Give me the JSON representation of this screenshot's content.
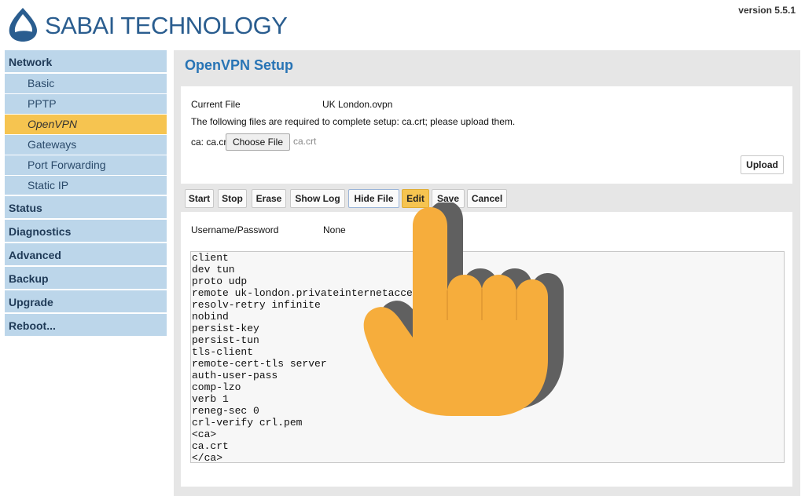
{
  "header": {
    "brand": "SABAI TECHNOLOGY",
    "version": "version 5.5.1"
  },
  "sidebar": {
    "sections": [
      {
        "label": "Network",
        "items": [
          "Basic",
          "PPTP",
          "OpenVPN",
          "Gateways",
          "Port Forwarding",
          "Static IP"
        ],
        "active_item": "OpenVPN"
      },
      {
        "label": "Status"
      },
      {
        "label": "Diagnostics"
      },
      {
        "label": "Advanced"
      },
      {
        "label": "Backup"
      },
      {
        "label": "Upgrade"
      },
      {
        "label": "Reboot..."
      }
    ]
  },
  "main": {
    "title": "OpenVPN Setup",
    "current_file_label": "Current File",
    "current_file_value": "UK London.ovpn",
    "required_note": "The following files are required to complete setup: ca.crt; please upload them.",
    "upload_field_label": "ca: ca.crt",
    "choose_file_label": "Choose File",
    "chosen_file": "ca.crt",
    "upload_label": "Upload",
    "toolbar": {
      "start": "Start",
      "stop": "Stop",
      "erase": "Erase",
      "show_log": "Show Log",
      "hide_file": "Hide File",
      "edit": "Edit",
      "save": "Save",
      "cancel": "Cancel"
    },
    "username_password_label": "Username/Password",
    "username_password_value": "None",
    "config_text": "client\ndev tun\nproto udp\nremote uk-london.privateinternetaccess.com 1194\nresolv-retry infinite\nnobind\npersist-key\npersist-tun\ntls-client\nremote-cert-tls server\nauth-user-pass\ncomp-lzo\nverb 1\nreneg-sec 0\ncrl-verify crl.pem\n<ca>\nca.crt\n</ca>"
  },
  "colors": {
    "brand_blue": "#2a5d8f",
    "title_blue": "#2874b5",
    "nav_bg": "#bcd6ea",
    "active_nav": "#f6c450",
    "hand_orange": "#f6ad3c"
  },
  "icons": {
    "logo": "sabai-logo-icon",
    "cursor": "hand-pointer-icon"
  }
}
